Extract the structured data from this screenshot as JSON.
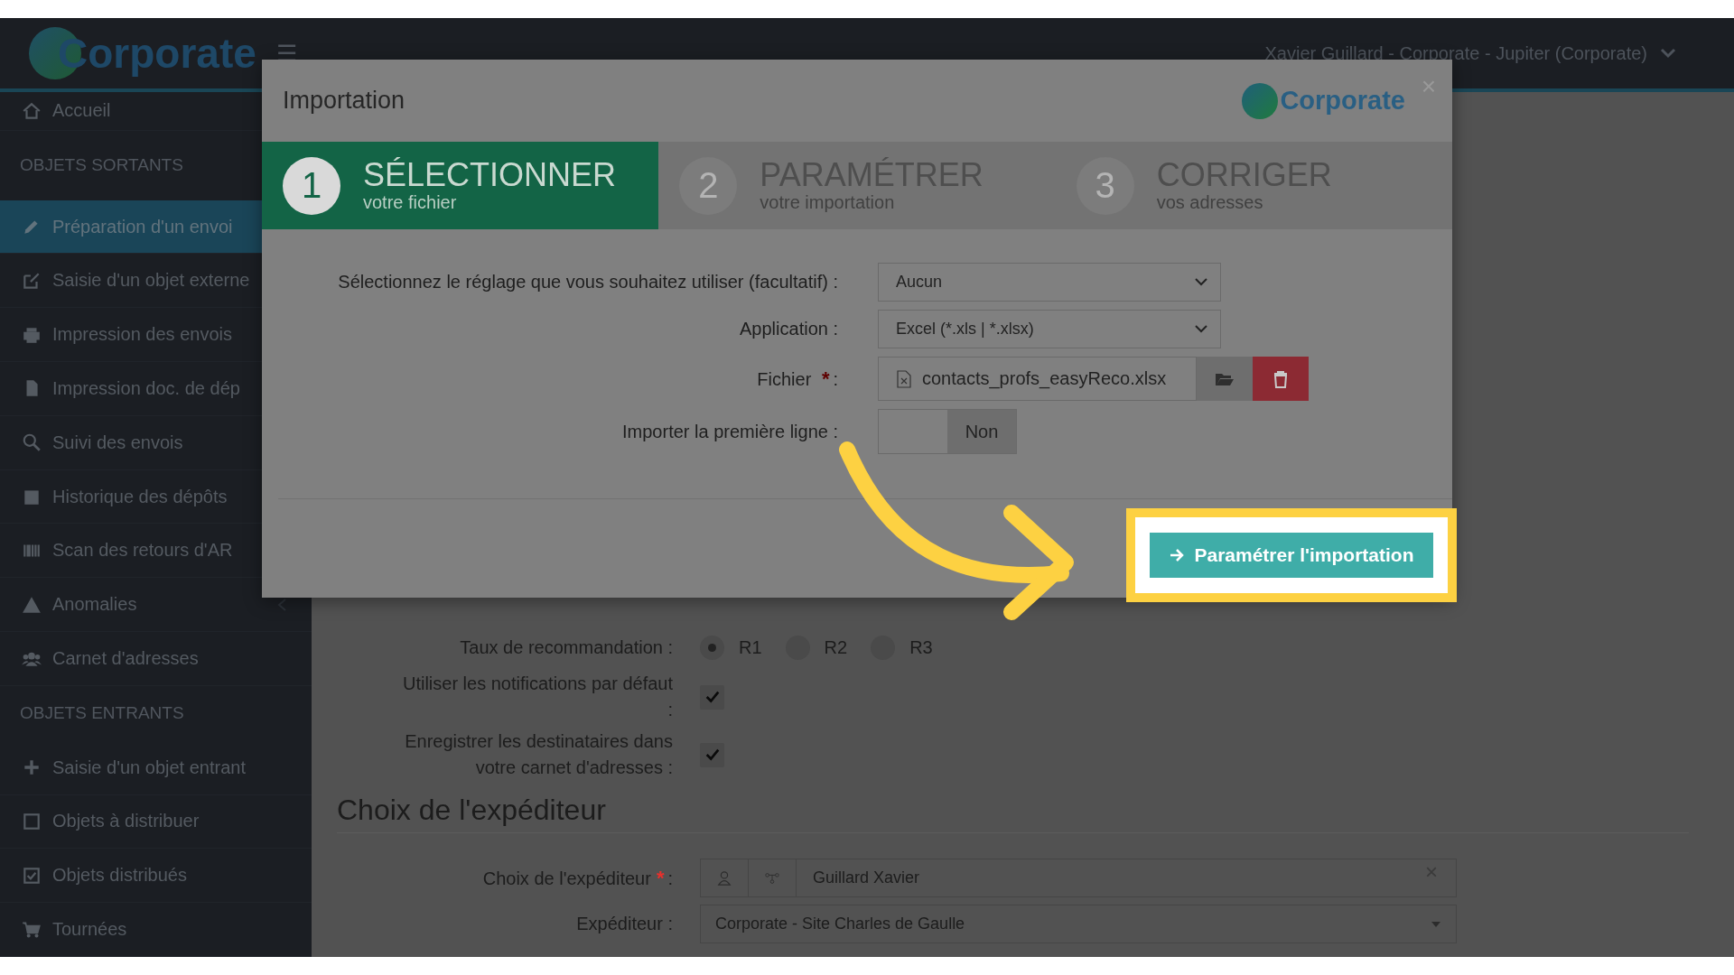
{
  "header": {
    "logo": "Corporate",
    "menu": "☰",
    "user": "Xavier Guillard - Corporate - Jupiter (Corporate)"
  },
  "sidebar": {
    "items": [
      {
        "kind": "link",
        "label": "Accueil",
        "selected": false
      },
      {
        "kind": "section",
        "label": "OBJETS SORTANTS"
      },
      {
        "kind": "link",
        "label": "Préparation d'un envoi",
        "selected": true
      },
      {
        "kind": "link",
        "label": "Saisie d'un objet externe",
        "selected": false
      },
      {
        "kind": "link",
        "label": "Impression des envois",
        "selected": false
      },
      {
        "kind": "link",
        "label": "Impression doc. de dép",
        "selected": false
      },
      {
        "kind": "link",
        "label": "Suivi des envois",
        "selected": false
      },
      {
        "kind": "link",
        "label": "Historique des dépôts",
        "selected": false
      },
      {
        "kind": "link",
        "label": "Scan des retours d'AR",
        "selected": false
      },
      {
        "kind": "link",
        "label": "Anomalies",
        "selected": false
      },
      {
        "kind": "link",
        "label": "Carnet d'adresses",
        "selected": false
      },
      {
        "kind": "section",
        "label": "OBJETS ENTRANTS"
      },
      {
        "kind": "link",
        "label": "Saisie d'un objet entrant",
        "selected": false
      },
      {
        "kind": "link",
        "label": "Objets à distribuer",
        "selected": false
      },
      {
        "kind": "link",
        "label": "Objets distribués",
        "selected": false
      },
      {
        "kind": "link",
        "label": "Tournées",
        "selected": false
      }
    ]
  },
  "main": {
    "rows": [
      {
        "kind": "radio",
        "label": "Taux de recommandation :",
        "options": [
          {
            "label": "R1",
            "selected": true
          },
          {
            "label": "R2",
            "selected": false
          },
          {
            "label": "R3",
            "selected": false
          }
        ]
      },
      {
        "kind": "checkbox",
        "label": "Utiliser les notifications par défaut :",
        "checked": true
      },
      {
        "kind": "checkbox",
        "label": "Enregistrer les destinataires dans votre carnet d'adresses :",
        "checked": true
      }
    ],
    "section_title": "Choix de l'expéditeur",
    "sender_rows": [
      {
        "kind": "picker",
        "label": "Choix de l'expéditeur",
        "required_mark": "*",
        "label_end": ":",
        "value": "Guillard Xavier",
        "clear": "×"
      },
      {
        "kind": "dropdown",
        "label": "Expéditeur :",
        "value": "Corporate - Site Charles de Gaulle"
      }
    ]
  },
  "modal": {
    "title": "Importation",
    "logo": "Corporate",
    "close": "×",
    "steps": [
      {
        "number": "1",
        "title": "SÉLECTIONNER",
        "subtitle": "votre fichier",
        "selected": true
      },
      {
        "number": "2",
        "title": "PARAMÉTRER",
        "subtitle": "votre importation",
        "selected": false
      },
      {
        "number": "3",
        "title": "CORRIGER",
        "subtitle": "vos adresses",
        "selected": false
      }
    ],
    "form": [
      {
        "kind": "select",
        "label": "Sélectionnez le réglage que vous souhaitez utiliser (facultatif) :",
        "value": "Aucun"
      },
      {
        "kind": "select",
        "label": "Application :",
        "value": "Excel (*.xls | *.xlsx)"
      },
      {
        "kind": "file",
        "label": "Fichier",
        "required_mark": "*",
        "label_end": ":",
        "value": "contacts_profs_easyReco.xlsx"
      },
      {
        "kind": "toggle",
        "label": "Importer la première ligne :",
        "value": "Non",
        "on": false
      }
    ],
    "button": {
      "label": "Paramétrer l'importation",
      "highlighted": true
    }
  }
}
